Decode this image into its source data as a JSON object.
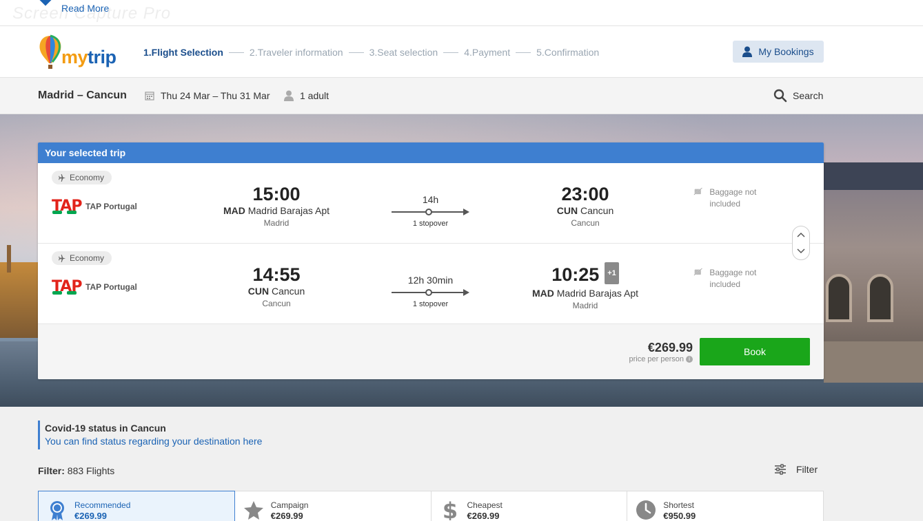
{
  "notice": {
    "read_more": "Read More"
  },
  "header": {
    "brand_a": "my",
    "brand_b": "trip",
    "steps": [
      "1.Flight Selection",
      "2.Traveler information",
      "3.Seat selection",
      "4.Payment",
      "5.Confirmation"
    ],
    "my_bookings": "My Bookings"
  },
  "search": {
    "route": "Madrid – Cancun",
    "dates": "Thu 24 Mar – Thu 31 Mar",
    "passengers": "1 adult",
    "search_label": "Search"
  },
  "trip": {
    "title": "Your selected trip",
    "legs": [
      {
        "cabin": "Economy",
        "airline": "TAP Portugal",
        "dep_time": "15:00",
        "dep_code": "MAD",
        "dep_airport": "Madrid Barajas Apt",
        "dep_city": "Madrid",
        "duration": "14h",
        "stops": "1 stopover",
        "arr_time": "23:00",
        "arr_code": "CUN",
        "arr_airport": "Cancun",
        "arr_city": "Cancun",
        "day_offset": "",
        "baggage": "Baggage not included"
      },
      {
        "cabin": "Economy",
        "airline": "TAP Portugal",
        "dep_time": "14:55",
        "dep_code": "CUN",
        "dep_airport": "Cancun",
        "dep_city": "Cancun",
        "duration": "12h 30min",
        "stops": "1 stopover",
        "arr_time": "10:25",
        "arr_code": "MAD",
        "arr_airport": "Madrid Barajas Apt",
        "arr_city": "Madrid",
        "day_offset": "+1",
        "baggage": "Baggage not included"
      }
    ],
    "price": "€269.99",
    "price_note": "price per person",
    "book_label": "Book"
  },
  "covid": {
    "title": "Covid-19 status in Cancun",
    "link": "You can find status regarding your destination here"
  },
  "filter": {
    "label": "Filter:",
    "count": "883 Flights",
    "button": "Filter"
  },
  "sort_tabs": [
    {
      "label": "Recommended",
      "value": "€269.99",
      "icon": "ribbon-icon"
    },
    {
      "label": "Campaign",
      "value": "€269.99",
      "icon": "star-icon"
    },
    {
      "label": "Cheapest",
      "value": "€269.99",
      "icon": "dollar-icon"
    },
    {
      "label": "Shortest",
      "value": "€950.99",
      "icon": "clock-icon"
    }
  ],
  "colors": {
    "accent": "#3e7fd0",
    "book": "#1aa61a",
    "brand_orange": "#f39c12",
    "brand_blue": "#1b63b4"
  }
}
